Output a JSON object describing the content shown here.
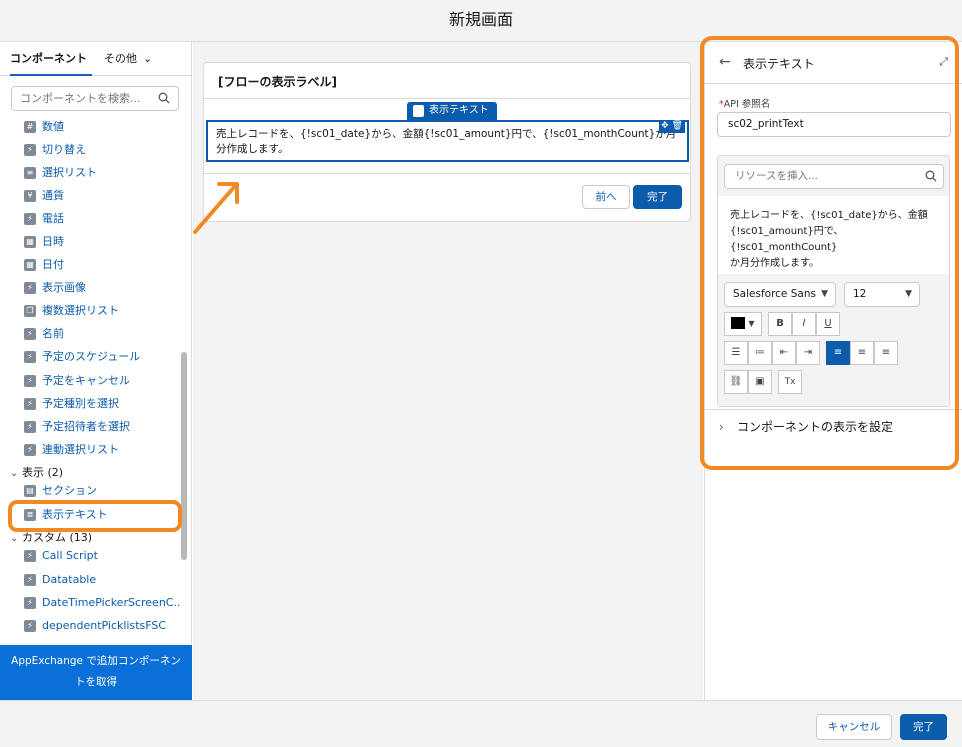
{
  "header": {
    "title": "新規画面"
  },
  "sidebar": {
    "tabs": {
      "components": "コンポーネント",
      "other": "その他"
    },
    "search_placeholder": "コンポーネントを検索...",
    "items": [
      {
        "label": "数値",
        "icon": "number-icon"
      },
      {
        "label": "切り替え",
        "icon": "lightning-icon"
      },
      {
        "label": "選択リスト",
        "icon": "list-icon"
      },
      {
        "label": "通貨",
        "icon": "currency-icon"
      },
      {
        "label": "電話",
        "icon": "lightning-icon"
      },
      {
        "label": "日時",
        "icon": "calendar-icon"
      },
      {
        "label": "日付",
        "icon": "calendar-icon"
      },
      {
        "label": "表示画像",
        "icon": "lightning-icon"
      },
      {
        "label": "複数選択リスト",
        "icon": "multiselect-icon"
      },
      {
        "label": "名前",
        "icon": "lightning-icon"
      },
      {
        "label": "予定のスケジュール",
        "icon": "lightning-icon"
      },
      {
        "label": "予定をキャンセル",
        "icon": "lightning-icon"
      },
      {
        "label": "予定種別を選択",
        "icon": "lightning-icon"
      },
      {
        "label": "予定招待者を選択",
        "icon": "lightning-icon"
      },
      {
        "label": "連動選択リスト",
        "icon": "lightning-icon"
      }
    ],
    "group_display": "表示 (2)",
    "display_items": [
      {
        "label": "セクション",
        "icon": "section-icon"
      },
      {
        "label": "表示テキスト",
        "icon": "display-text-icon"
      }
    ],
    "group_custom": "カスタム (13)",
    "custom_items": [
      {
        "label": "Call Script",
        "icon": "lightning-icon"
      },
      {
        "label": "Datatable",
        "icon": "lightning-icon"
      },
      {
        "label": "DateTimePickerScreenC...",
        "icon": "lightning-icon"
      },
      {
        "label": "dependentPicklistsFSC",
        "icon": "lightning-icon"
      }
    ],
    "appexchange": "AppExchange で追加コンポーネントを取得"
  },
  "canvas": {
    "screen_title": "[フローの表示ラベル]",
    "component_tag": "表示テキスト",
    "text_content": "売上レコードを、{!sc01_date}から、金額{!sc01_amount}円で、{!sc01_monthCount}か月分作成します。",
    "prev_button": "前へ",
    "done_button": "完了"
  },
  "panel": {
    "title": "表示テキスト",
    "api_label_required": "*",
    "api_label": "API 参照名",
    "api_value": "sc02_printText",
    "resource_placeholder": "リソースを挿入...",
    "editor_line1": "売上レコードを、{!sc01_date}から、金額",
    "editor_line2": "{!sc01_amount}円で、{!sc01_monthCount}",
    "editor_line3": "か月分作成します。",
    "font_family": "Salesforce Sans",
    "font_size": "12",
    "bold": "B",
    "italic": "I",
    "underline": "U",
    "clear_format": "Tx",
    "visibility": "コンポーネントの表示を設定"
  },
  "footer": {
    "cancel": "キャンセル",
    "finish": "完了"
  },
  "colors": {
    "brand": "#0b5cab",
    "highlight": "#f08a24",
    "text_color": "#000000"
  }
}
